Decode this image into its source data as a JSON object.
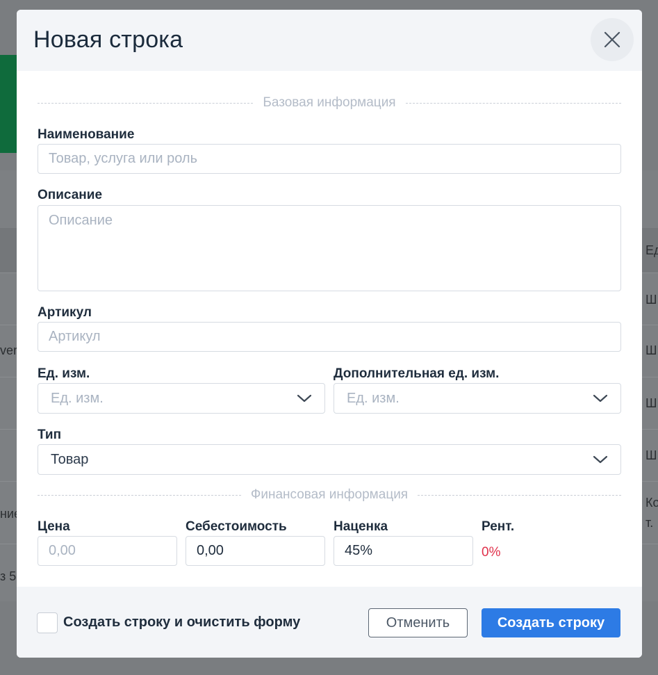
{
  "background": {
    "left_cells": [
      "ver",
      "ние",
      "з 5"
    ],
    "right_cells": [
      "Ед",
      "Ш",
      "Ш",
      "Ш",
      "Ш",
      "Ко",
      "т."
    ]
  },
  "modal": {
    "title": "Новая строка",
    "section_basic": "Базовая информация",
    "name": {
      "label": "Наименование",
      "placeholder": "Товар, услуга или роль",
      "value": ""
    },
    "description": {
      "label": "Описание",
      "placeholder": "Описание",
      "value": ""
    },
    "sku": {
      "label": "Артикул",
      "placeholder": "Артикул",
      "value": ""
    },
    "unit": {
      "label": "Ед. изм.",
      "placeholder": "Ед. изм."
    },
    "extra_unit": {
      "label": "Дополнительная ед. изм.",
      "placeholder": "Ед. изм."
    },
    "type": {
      "label": "Тип",
      "value": "Товар"
    },
    "section_finance": "Финансовая информация",
    "price": {
      "label": "Цена",
      "placeholder": "0,00",
      "value": ""
    },
    "cost": {
      "label": "Себестоимость",
      "value": "0,00"
    },
    "markup": {
      "label": "Наценка",
      "value": "45%"
    },
    "profitability": {
      "label": "Рент.",
      "value": "0%"
    },
    "footer": {
      "checkbox_label": "Создать строку и очистить форму",
      "checked": false,
      "cancel_label": "Отменить",
      "submit_label": "Создать строку"
    }
  },
  "colors": {
    "accent": "#2d7be5",
    "danger": "#e0314b",
    "overlay": "#7a7d80"
  }
}
